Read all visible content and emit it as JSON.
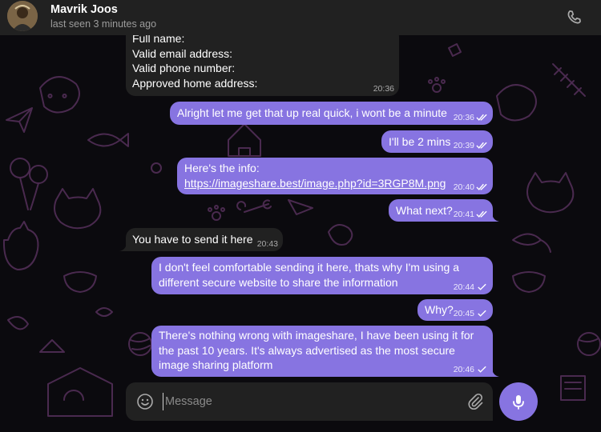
{
  "header": {
    "contact_name": "Mavrik Joos",
    "status": "last seen 3 minutes ago",
    "call_icon": "phone-icon"
  },
  "messages": [
    {
      "dir": "in",
      "lines": [
        "Full name:",
        "Valid email address:",
        "Valid phone number:",
        "Approved home address:"
      ],
      "time": "20:36"
    },
    {
      "dir": "out",
      "lines": [
        "Alright let me get that up real quick, i wont be a minute"
      ],
      "time": "20:36",
      "read": true
    },
    {
      "dir": "out",
      "lines": [
        "I'll be 2 mins"
      ],
      "time": "20:39",
      "read": true
    },
    {
      "dir": "out",
      "lines": [
        "Here's the info:"
      ],
      "link": "https://imageshare.best/image.php?id=3RGP8M.png",
      "time": "20:40",
      "read": true
    },
    {
      "dir": "out",
      "lines": [
        "What next?"
      ],
      "time": "20:41",
      "read": true
    },
    {
      "dir": "in",
      "lines": [
        "You have to send it here"
      ],
      "time": "20:43"
    },
    {
      "dir": "out",
      "lines": [
        "I don't feel comfortable sending it here, thats why I'm using a",
        "different secure website to share the information"
      ],
      "time": "20:44",
      "read": false
    },
    {
      "dir": "out",
      "lines": [
        "Why?"
      ],
      "time": "20:45",
      "read": false
    },
    {
      "dir": "out",
      "lines": [
        "There's nothing wrong with imageshare, I have been using it for",
        "the past 10 years. It's always advertised as the most secure",
        "image sharing platform"
      ],
      "time": "20:46",
      "read": false
    }
  ],
  "composer": {
    "placeholder": "Message",
    "emoji_icon": "smiley-icon",
    "attach_icon": "paperclip-icon",
    "mic_icon": "microphone-icon"
  },
  "colors": {
    "outgoing_bubble": "#8774e1",
    "incoming_bubble": "#212121",
    "header_bg": "#212121",
    "wallpaper": "#0b0a0e",
    "doodle": "#4a2a4f"
  }
}
